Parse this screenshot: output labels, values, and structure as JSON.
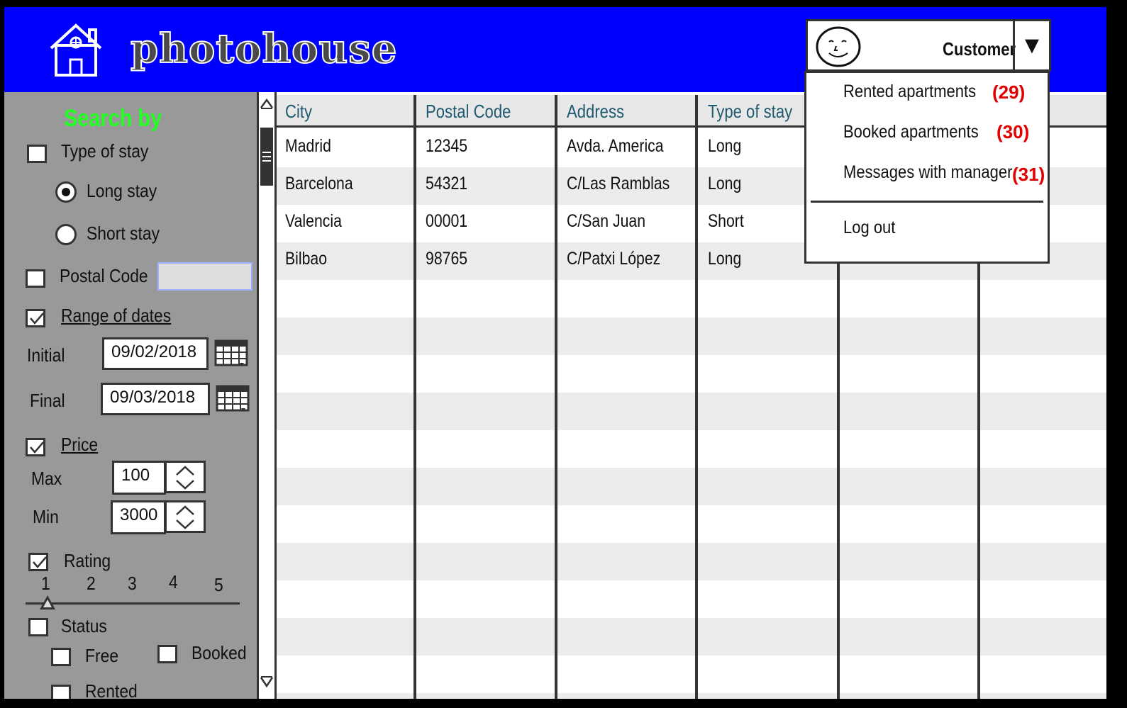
{
  "app": {
    "name": "photohouse"
  },
  "user": {
    "role": "Customer",
    "menu": [
      {
        "label": "Rented apartments",
        "badge": "(29)"
      },
      {
        "label": "Booked apartments",
        "badge": "(30)"
      },
      {
        "label": "Messages with manager",
        "badge": "(31)"
      },
      {
        "label": "Log out"
      }
    ]
  },
  "sidebar": {
    "title": "Search by",
    "type_of_stay": {
      "label": "Type of stay",
      "checked": false,
      "options": [
        {
          "label": "Long stay",
          "selected": true
        },
        {
          "label": "Short stay",
          "selected": false
        }
      ]
    },
    "postal_code": {
      "label": "Postal Code",
      "checked": false,
      "value": ""
    },
    "range_of_dates": {
      "label": "Range of dates",
      "checked": true,
      "initial_label": "Initial",
      "initial_value": "09/02/2018",
      "final_label": "Final",
      "final_value": "09/03/2018"
    },
    "price": {
      "label": "Price",
      "checked": true,
      "max_label": "Max",
      "max_value": "100",
      "min_label": "Min",
      "min_value": "3000"
    },
    "rating": {
      "label": "Rating",
      "checked": true,
      "scale": [
        "1",
        "2",
        "3",
        "4",
        "5"
      ],
      "selected": 1
    },
    "status": {
      "label": "Status",
      "checked": false,
      "options": [
        {
          "label": "Free",
          "checked": false
        },
        {
          "label": "Booked",
          "checked": false
        },
        {
          "label": "Rented",
          "checked": false
        }
      ]
    }
  },
  "table": {
    "columns": [
      "City",
      "Postal Code",
      "Address",
      "Type of stay"
    ],
    "rows": [
      [
        "Madrid",
        "12345",
        "Avda. America",
        "Long"
      ],
      [
        "Barcelona",
        "54321",
        "C/Las Ramblas",
        "Long"
      ],
      [
        "Valencia",
        "00001",
        "C/San Juan",
        "Short"
      ],
      [
        "Bilbao",
        "98765",
        "C/Patxi López",
        "Long"
      ]
    ]
  },
  "colors": {
    "header_bg": "#0000ff",
    "sidebar_bg": "#999999",
    "title_green": "#22ff22",
    "badge_red": "#e00000",
    "column_header_text": "#1f5a70"
  },
  "icons": [
    "house-icon",
    "smiley-avatar-icon",
    "caret-down-icon",
    "calendar-icon",
    "spinner-up-icon",
    "spinner-down-icon",
    "scroll-up-icon",
    "scroll-down-icon",
    "check-icon"
  ]
}
